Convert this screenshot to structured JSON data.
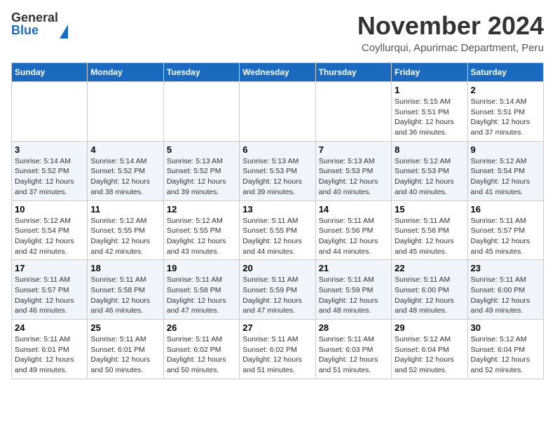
{
  "header": {
    "logo_line1": "General",
    "logo_line2": "Blue",
    "main_title": "November 2024",
    "subtitle": "Coyllurqui, Apurimac Department, Peru"
  },
  "calendar": {
    "days_of_week": [
      "Sunday",
      "Monday",
      "Tuesday",
      "Wednesday",
      "Thursday",
      "Friday",
      "Saturday"
    ],
    "weeks": [
      {
        "days": [
          {
            "num": "",
            "info": ""
          },
          {
            "num": "",
            "info": ""
          },
          {
            "num": "",
            "info": ""
          },
          {
            "num": "",
            "info": ""
          },
          {
            "num": "",
            "info": ""
          },
          {
            "num": "1",
            "info": "Sunrise: 5:15 AM\nSunset: 5:51 PM\nDaylight: 12 hours\nand 36 minutes."
          },
          {
            "num": "2",
            "info": "Sunrise: 5:14 AM\nSunset: 5:51 PM\nDaylight: 12 hours\nand 37 minutes."
          }
        ]
      },
      {
        "days": [
          {
            "num": "3",
            "info": "Sunrise: 5:14 AM\nSunset: 5:52 PM\nDaylight: 12 hours\nand 37 minutes."
          },
          {
            "num": "4",
            "info": "Sunrise: 5:14 AM\nSunset: 5:52 PM\nDaylight: 12 hours\nand 38 minutes."
          },
          {
            "num": "5",
            "info": "Sunrise: 5:13 AM\nSunset: 5:52 PM\nDaylight: 12 hours\nand 39 minutes."
          },
          {
            "num": "6",
            "info": "Sunrise: 5:13 AM\nSunset: 5:53 PM\nDaylight: 12 hours\nand 39 minutes."
          },
          {
            "num": "7",
            "info": "Sunrise: 5:13 AM\nSunset: 5:53 PM\nDaylight: 12 hours\nand 40 minutes."
          },
          {
            "num": "8",
            "info": "Sunrise: 5:12 AM\nSunset: 5:53 PM\nDaylight: 12 hours\nand 40 minutes."
          },
          {
            "num": "9",
            "info": "Sunrise: 5:12 AM\nSunset: 5:54 PM\nDaylight: 12 hours\nand 41 minutes."
          }
        ]
      },
      {
        "days": [
          {
            "num": "10",
            "info": "Sunrise: 5:12 AM\nSunset: 5:54 PM\nDaylight: 12 hours\nand 42 minutes."
          },
          {
            "num": "11",
            "info": "Sunrise: 5:12 AM\nSunset: 5:55 PM\nDaylight: 12 hours\nand 42 minutes."
          },
          {
            "num": "12",
            "info": "Sunrise: 5:12 AM\nSunset: 5:55 PM\nDaylight: 12 hours\nand 43 minutes."
          },
          {
            "num": "13",
            "info": "Sunrise: 5:11 AM\nSunset: 5:55 PM\nDaylight: 12 hours\nand 44 minutes."
          },
          {
            "num": "14",
            "info": "Sunrise: 5:11 AM\nSunset: 5:56 PM\nDaylight: 12 hours\nand 44 minutes."
          },
          {
            "num": "15",
            "info": "Sunrise: 5:11 AM\nSunset: 5:56 PM\nDaylight: 12 hours\nand 45 minutes."
          },
          {
            "num": "16",
            "info": "Sunrise: 5:11 AM\nSunset: 5:57 PM\nDaylight: 12 hours\nand 45 minutes."
          }
        ]
      },
      {
        "days": [
          {
            "num": "17",
            "info": "Sunrise: 5:11 AM\nSunset: 5:57 PM\nDaylight: 12 hours\nand 46 minutes."
          },
          {
            "num": "18",
            "info": "Sunrise: 5:11 AM\nSunset: 5:58 PM\nDaylight: 12 hours\nand 46 minutes."
          },
          {
            "num": "19",
            "info": "Sunrise: 5:11 AM\nSunset: 5:58 PM\nDaylight: 12 hours\nand 47 minutes."
          },
          {
            "num": "20",
            "info": "Sunrise: 5:11 AM\nSunset: 5:59 PM\nDaylight: 12 hours\nand 47 minutes."
          },
          {
            "num": "21",
            "info": "Sunrise: 5:11 AM\nSunset: 5:59 PM\nDaylight: 12 hours\nand 48 minutes."
          },
          {
            "num": "22",
            "info": "Sunrise: 5:11 AM\nSunset: 6:00 PM\nDaylight: 12 hours\nand 48 minutes."
          },
          {
            "num": "23",
            "info": "Sunrise: 5:11 AM\nSunset: 6:00 PM\nDaylight: 12 hours\nand 49 minutes."
          }
        ]
      },
      {
        "days": [
          {
            "num": "24",
            "info": "Sunrise: 5:11 AM\nSunset: 6:01 PM\nDaylight: 12 hours\nand 49 minutes."
          },
          {
            "num": "25",
            "info": "Sunrise: 5:11 AM\nSunset: 6:01 PM\nDaylight: 12 hours\nand 50 minutes."
          },
          {
            "num": "26",
            "info": "Sunrise: 5:11 AM\nSunset: 6:02 PM\nDaylight: 12 hours\nand 50 minutes."
          },
          {
            "num": "27",
            "info": "Sunrise: 5:11 AM\nSunset: 6:02 PM\nDaylight: 12 hours\nand 51 minutes."
          },
          {
            "num": "28",
            "info": "Sunrise: 5:11 AM\nSunset: 6:03 PM\nDaylight: 12 hours\nand 51 minutes."
          },
          {
            "num": "29",
            "info": "Sunrise: 5:12 AM\nSunset: 6:04 PM\nDaylight: 12 hours\nand 52 minutes."
          },
          {
            "num": "30",
            "info": "Sunrise: 5:12 AM\nSunset: 6:04 PM\nDaylight: 12 hours\nand 52 minutes."
          }
        ]
      }
    ]
  }
}
